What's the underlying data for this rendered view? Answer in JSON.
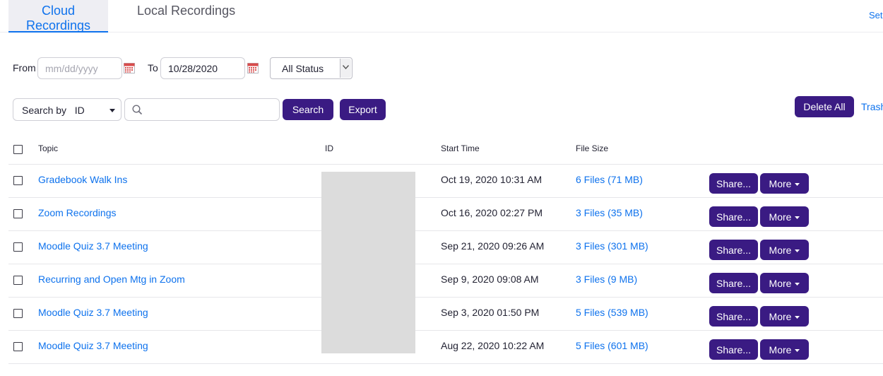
{
  "tabs": [
    {
      "label": "Cloud Recordings",
      "active": true
    },
    {
      "label": "Local Recordings",
      "active": false
    }
  ],
  "header_right_link": "Set",
  "filters": {
    "from_label": "From",
    "from_placeholder": "mm/dd/yyyy",
    "to_label": "To",
    "to_value": "10/28/2020",
    "status_selected": "All Status"
  },
  "search": {
    "search_by_label": "Search by",
    "search_by_value": "ID",
    "search_button": "Search",
    "export_button": "Export",
    "delete_all_button": "Delete All",
    "trash_link": "Trash"
  },
  "table": {
    "columns": [
      "Topic",
      "ID",
      "Start Time",
      "File Size"
    ],
    "share_label": "Share...",
    "more_label": "More",
    "rows": [
      {
        "topic": "Gradebook Walk Ins",
        "start_time": "Oct 19, 2020 10:31 AM",
        "file_size": "6 Files (71 MB)"
      },
      {
        "topic": "Zoom Recordings",
        "start_time": "Oct 16, 2020 02:27 PM",
        "file_size": "3 Files (35 MB)"
      },
      {
        "topic": "Moodle Quiz 3.7 Meeting",
        "start_time": "Sep 21, 2020 09:26 AM",
        "file_size": "3 Files (301 MB)"
      },
      {
        "topic": "Recurring and Open Mtg in Zoom",
        "start_time": "Sep 9, 2020 09:08 AM",
        "file_size": "3 Files (9 MB)"
      },
      {
        "topic": "Moodle Quiz 3.7 Meeting",
        "start_time": "Sep 3, 2020 01:50 PM",
        "file_size": "5 Files (539 MB)"
      },
      {
        "topic": "Moodle Quiz 3.7 Meeting",
        "start_time": "Aug 22, 2020 10:22 AM",
        "file_size": "5 Files (601 MB)"
      }
    ]
  },
  "colors": {
    "accent_blue": "#0e72ed",
    "button_purple": "#3a1b83",
    "id_redaction_gray": "#dcdcdc"
  },
  "icons": [
    "calendar-icon",
    "search-icon",
    "chevron-down-icon"
  ]
}
